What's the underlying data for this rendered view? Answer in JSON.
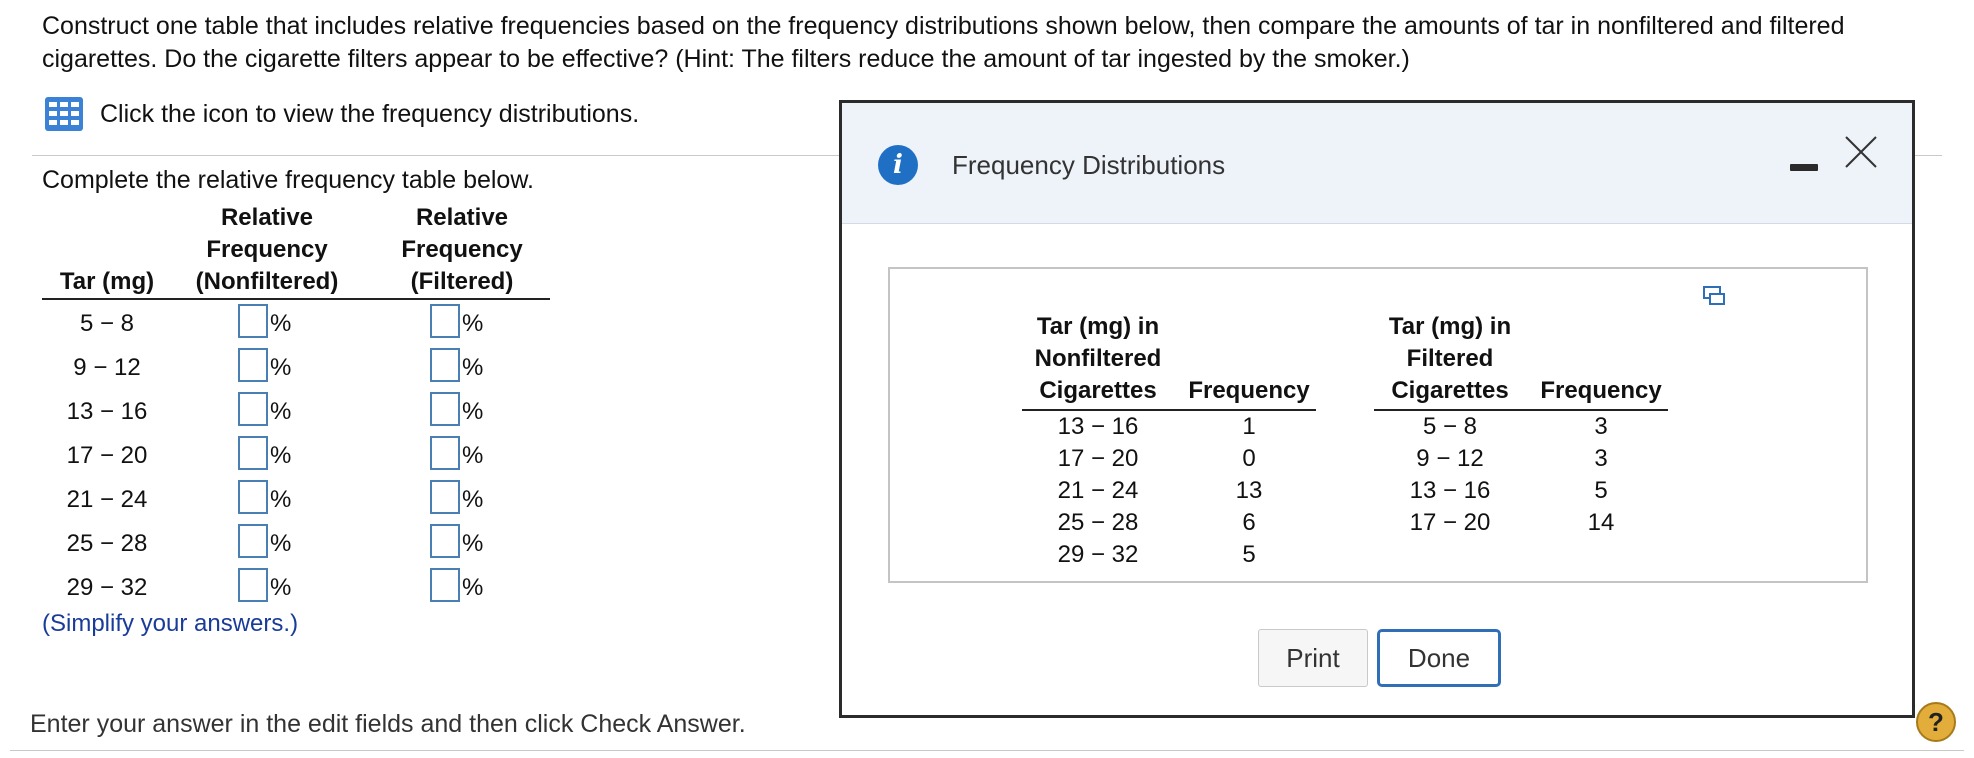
{
  "question": "Construct one table that includes relative frequencies based on the frequency distributions shown below, then compare the amounts of tar in nonfiltered and filtered cigarettes. Do the cigarette filters appear to be effective? (Hint: The filters reduce the amount of tar ingested by the smoker.)",
  "icon_prompt": "Click the icon to view the frequency distributions.",
  "complete_label": "Complete the relative frequency table below.",
  "table": {
    "col_tar": "Tar (mg)",
    "col_nf": [
      "Relative",
      "Frequency",
      "(Nonfiltered)"
    ],
    "col_f": [
      "Relative",
      "Frequency",
      "(Filtered)"
    ],
    "pct_symbol": "%",
    "rows": [
      "5 − 8",
      "9 − 12",
      "13 − 16",
      "17 − 20",
      "21 − 24",
      "25 − 28",
      "29 − 32"
    ],
    "nf_values": [
      "",
      "",
      "",
      "",
      "",
      "",
      ""
    ],
    "f_values": [
      "",
      "",
      "",
      "",
      "",
      "",
      ""
    ]
  },
  "simplify": "(Simplify your answers.)",
  "enter_prompt": "Enter your answer in the edit fields and then click Check Answer.",
  "dialog": {
    "title": "Frequency Distributions",
    "nonfiltered_header": [
      "Tar (mg) in",
      "Nonfiltered",
      "Cigarettes"
    ],
    "filtered_header": [
      "Tar (mg) in",
      "Filtered",
      "Cigarettes"
    ],
    "frequency_header": "Frequency",
    "nonfiltered": [
      {
        "range": "13 − 16",
        "freq": "1"
      },
      {
        "range": "17 − 20",
        "freq": "0"
      },
      {
        "range": "21 − 24",
        "freq": "13"
      },
      {
        "range": "25 − 28",
        "freq": "6"
      },
      {
        "range": "29 − 32",
        "freq": "5"
      }
    ],
    "filtered": [
      {
        "range": "5 − 8",
        "freq": "3"
      },
      {
        "range": "9 − 12",
        "freq": "3"
      },
      {
        "range": "13 − 16",
        "freq": "5"
      },
      {
        "range": "17 − 20",
        "freq": "14"
      }
    ],
    "print_label": "Print",
    "done_label": "Done"
  },
  "help_label": "?",
  "colors": {
    "accent": "#1f6fc5",
    "input_border": "#4a7fb3",
    "hint_text": "#1a3c99",
    "help": "#e2ad3a"
  }
}
